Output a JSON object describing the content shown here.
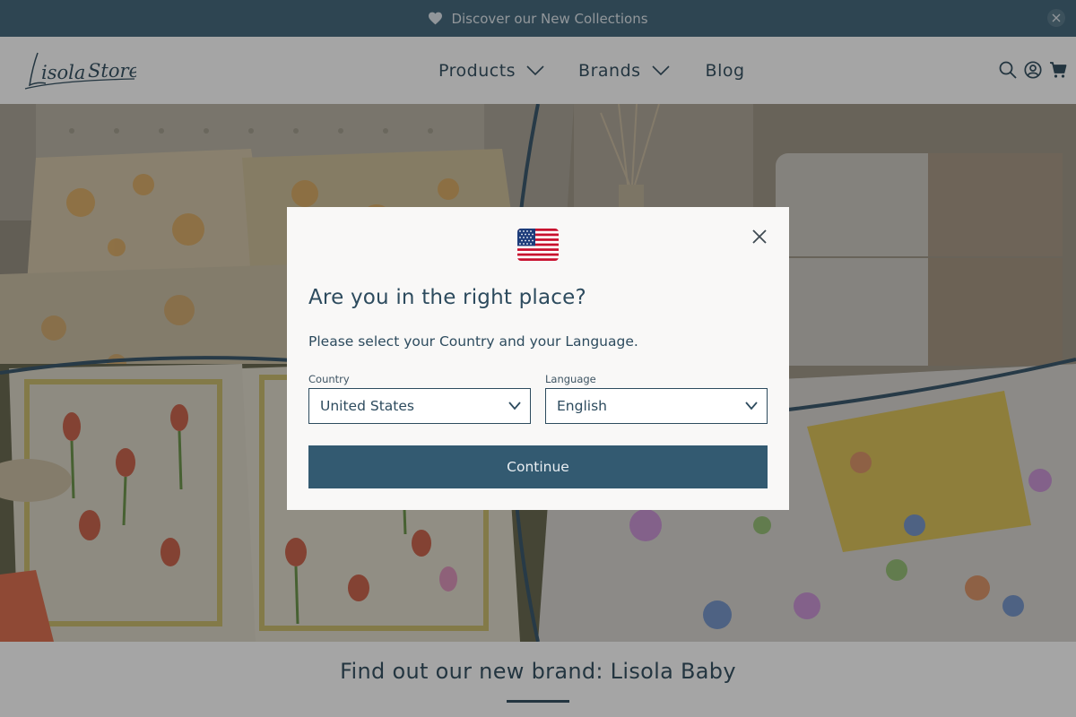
{
  "announcement": {
    "text": "Discover our New Collections",
    "icon": "heart-icon",
    "close_icon": "close-icon"
  },
  "header": {
    "logo_text": "LisolaStore",
    "nav": [
      {
        "label": "Products",
        "has_dropdown": true
      },
      {
        "label": "Brands",
        "has_dropdown": true
      },
      {
        "label": "Blog",
        "has_dropdown": false
      }
    ],
    "icons": [
      "search-icon",
      "account-icon",
      "cart-icon"
    ]
  },
  "modal": {
    "flag_icon": "us-flag-icon",
    "close_icon": "close-icon",
    "title": "Are you in the right place?",
    "subtitle": "Please select your Country and your Language.",
    "country": {
      "label": "Country",
      "value": "United States"
    },
    "language": {
      "label": "Language",
      "value": "English"
    },
    "continue_label": "Continue"
  },
  "below_hero": {
    "title": "Find out our new brand: Lisola Baby"
  },
  "colors": {
    "brand_dark": "#1f3e51",
    "brand_blue": "#335a71",
    "modal_bg": "#f9f8f7"
  }
}
